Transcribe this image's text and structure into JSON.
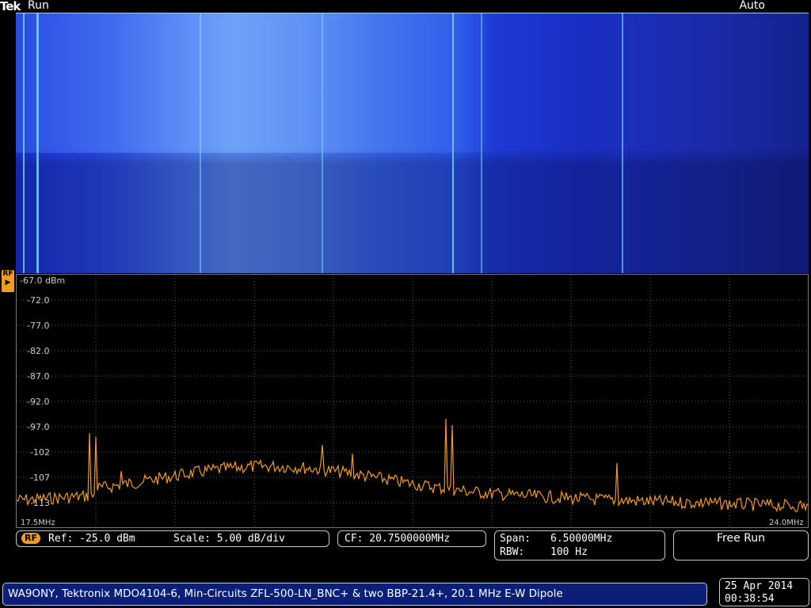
{
  "header": {
    "brand": "Tek",
    "status": "Run",
    "trigger_mode": "Auto"
  },
  "marker": {
    "label": "RF"
  },
  "spectrum": {
    "reference_level": "-67.0 dBm",
    "y_ticks": [
      "-72.0",
      "-77.0",
      "-82.0",
      "-87.0",
      "-92.0",
      "-97.0",
      "-102",
      "-107",
      "-113"
    ],
    "start_freq": "17.5MHz",
    "stop_freq": "24.0MHz",
    "trace_color": "#f39a20",
    "grid_color": "#5a5a5a"
  },
  "readouts": {
    "rf_badge": "RF",
    "ref": "Ref: -25.0 dBm",
    "scale": "Scale: 5.00 dB/div",
    "cf": "CF:  20.7500000MHz",
    "span_label": "Span:",
    "span_value": "6.50000MHz",
    "rbw_label": "RBW:",
    "rbw_value": "100 Hz",
    "acquisition": "Free Run"
  },
  "footer": {
    "note": "WA9ONY, Tektronix MDO4104-6, Min-Circuits ZFL-500-LN_BNC+ & two BBP-21.4+, 20.1 MHz E-W Dipole"
  },
  "clock": {
    "date": "25 Apr 2014",
    "time": "00:38:54"
  }
}
